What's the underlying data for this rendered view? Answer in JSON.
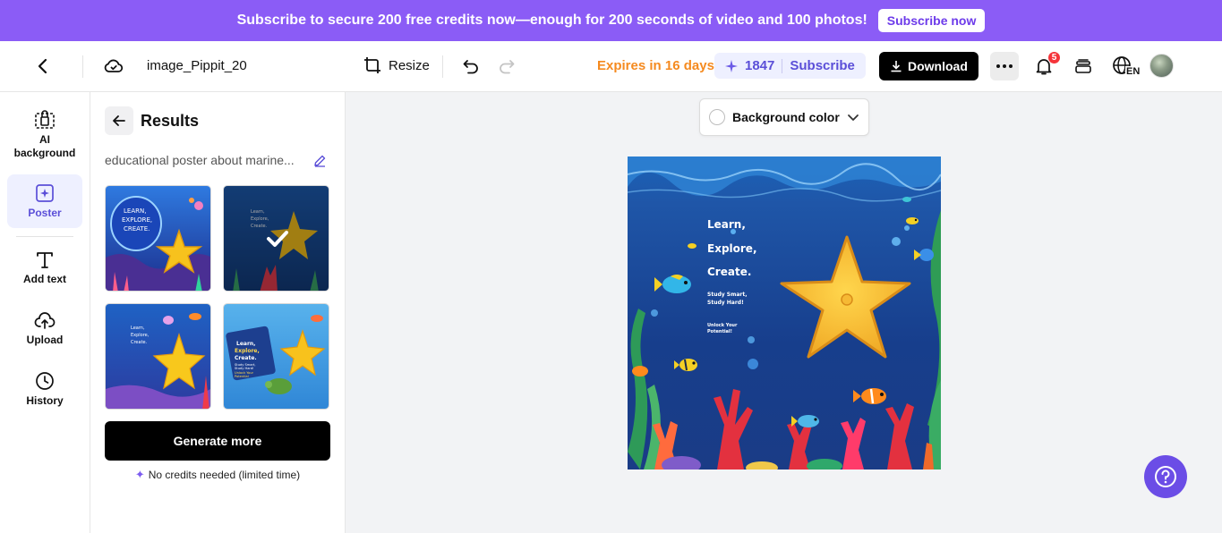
{
  "promo": {
    "text": "Subscribe to secure 200 free credits now—enough for 200 seconds of video and 100 photos!",
    "button": "Subscribe now"
  },
  "header": {
    "filename": "image_Pippit_20",
    "resize": "Resize",
    "expires": "Expires in 16 days",
    "credits": "1847",
    "subscribe": "Subscribe",
    "download": "Download",
    "notification_count": "5",
    "language": "EN"
  },
  "rail": {
    "items": [
      {
        "label_line1": "AI",
        "label_line2": "background",
        "icon": "ai-background-icon"
      },
      {
        "label": "Poster",
        "icon": "poster-icon",
        "active": true
      },
      {
        "label": "Add text",
        "icon": "text-icon"
      },
      {
        "label": "Upload",
        "icon": "upload-icon"
      },
      {
        "label": "History",
        "icon": "clock-icon"
      }
    ]
  },
  "panel": {
    "title": "Results",
    "prompt": "educational poster about marine...",
    "generate_button": "Generate more",
    "note": "No credits needed (limited time)"
  },
  "thumbnails": {
    "t1": {
      "l1": "LEARN,",
      "l2": "EXPLORE,",
      "l3": "CREATE."
    },
    "t2": {
      "l1": "Learn,",
      "l2": "Explore,",
      "l3": "Create."
    },
    "t3": {
      "l1": "Learn,",
      "l2": "Explore,",
      "l3": "Create."
    },
    "t4": {
      "l1": "Learn,",
      "l2": "Explore,",
      "l3": "Create.",
      "l4": "Study Smart,",
      "l5": "Study Hard!",
      "l6": "Unlock Your",
      "l7": "Potential"
    }
  },
  "canvas": {
    "background_color_label": "Background color",
    "poster": {
      "line1": "Learn,",
      "line2": "Explore,",
      "line3": "Create.",
      "sub1": "Study Smart,",
      "sub2": "Study Hard!",
      "sub3": "Unlock Your",
      "sub4": "Potential!"
    }
  },
  "colors": {
    "brand": "#8b5cf6",
    "accent": "#5b4fd8",
    "expires": "#f58a1f",
    "help": "#6b4de6"
  }
}
